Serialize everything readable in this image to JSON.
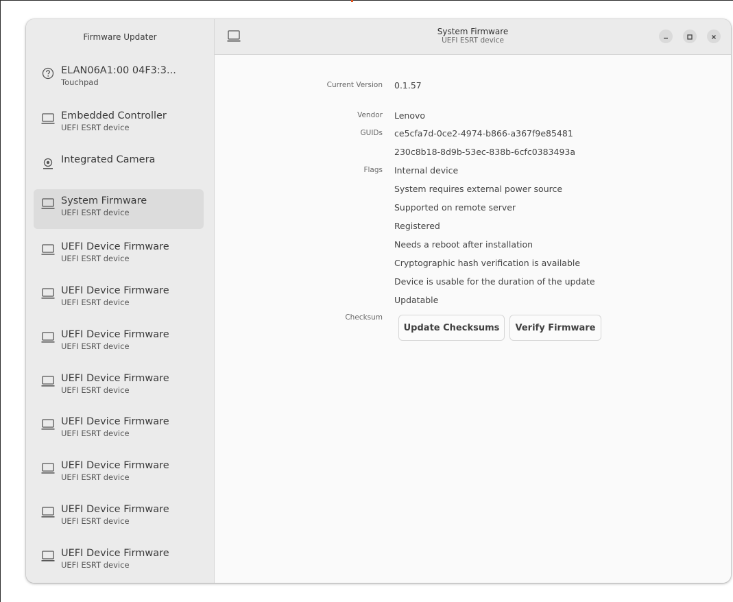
{
  "sidebar": {
    "title": "Firmware Updater",
    "devices": [
      {
        "name": "ELAN06A1:00 04F3:3...",
        "sub": "Touchpad",
        "icon": "help-circle-icon"
      },
      {
        "name": "Embedded Controller",
        "sub": "UEFI ESRT device",
        "icon": "computer-icon"
      },
      {
        "name": "Integrated Camera",
        "sub": "",
        "icon": "camera-icon"
      },
      {
        "name": "System Firmware",
        "sub": "UEFI ESRT device",
        "icon": "computer-icon",
        "selected": true
      },
      {
        "name": "UEFI Device Firmware",
        "sub": "UEFI ESRT device",
        "icon": "computer-icon"
      },
      {
        "name": "UEFI Device Firmware",
        "sub": "UEFI ESRT device",
        "icon": "computer-icon"
      },
      {
        "name": "UEFI Device Firmware",
        "sub": "UEFI ESRT device",
        "icon": "computer-icon"
      },
      {
        "name": "UEFI Device Firmware",
        "sub": "UEFI ESRT device",
        "icon": "computer-icon"
      },
      {
        "name": "UEFI Device Firmware",
        "sub": "UEFI ESRT device",
        "icon": "computer-icon"
      },
      {
        "name": "UEFI Device Firmware",
        "sub": "UEFI ESRT device",
        "icon": "computer-icon"
      },
      {
        "name": "UEFI Device Firmware",
        "sub": "UEFI ESRT device",
        "icon": "computer-icon"
      },
      {
        "name": "UEFI Device Firmware",
        "sub": "UEFI ESRT device",
        "icon": "computer-icon"
      }
    ]
  },
  "header": {
    "title": "System Firmware",
    "subtitle": "UEFI ESRT device",
    "icon": "computer-icon"
  },
  "details": {
    "current_version_label": "Current Version",
    "current_version": "0.1.57",
    "vendor_label": "Vendor",
    "vendor": "Lenovo",
    "guids_label": "GUIDs",
    "guids": [
      "ce5cfa7d-0ce2-4974-b866-a367f9e85481",
      "230c8b18-8d9b-53ec-838b-6cfc0383493a"
    ],
    "flags_label": "Flags",
    "flags": [
      "Internal device",
      "System requires external power source",
      "Supported on remote server",
      "Registered",
      "Needs a reboot after installation",
      "Cryptographic hash verification is available",
      "Device is usable for the duration of the update",
      "Updatable"
    ],
    "checksum_label": "Checksum",
    "update_checksums_label": "Update Checksums",
    "verify_firmware_label": "Verify Firmware"
  },
  "colors": {
    "accent": "#e0531f",
    "sidebar_bg": "#ebebeb",
    "selected_bg": "#dcdcdc",
    "content_bg": "#fafafa"
  }
}
